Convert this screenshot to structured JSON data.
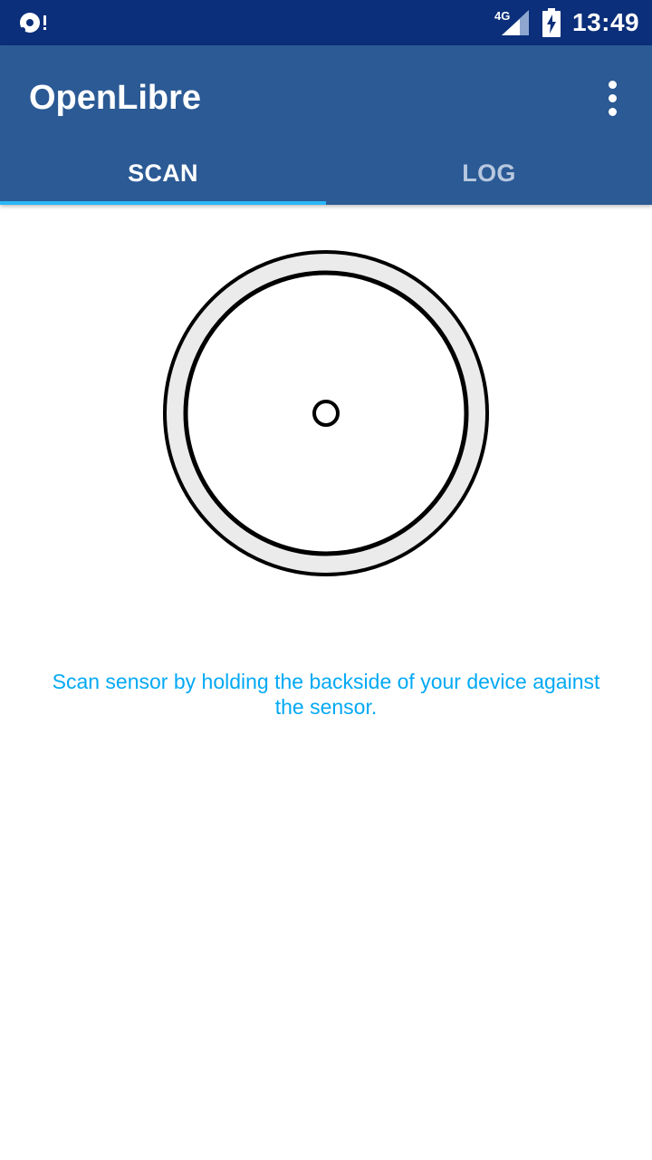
{
  "status_bar": {
    "notification_icon": "sync-alert-icon",
    "network_label": "4G",
    "network_icon": "signal-icon",
    "battery_icon": "battery-charging-icon",
    "time": "13:49"
  },
  "app_bar": {
    "title": "OpenLibre",
    "overflow_icon": "more-vertical-icon",
    "background_color": "#2b5a95"
  },
  "tabs": [
    {
      "label": "SCAN",
      "active": true
    },
    {
      "label": "LOG",
      "active": false
    }
  ],
  "main": {
    "sensor_icon": "sensor-icon",
    "instruction": "Scan sensor by holding the backside of your device against the sensor.",
    "instruction_color": "#03a9f4"
  },
  "colors": {
    "status_bar": "#0b2f7a",
    "tab_indicator": "#29b6f6"
  }
}
